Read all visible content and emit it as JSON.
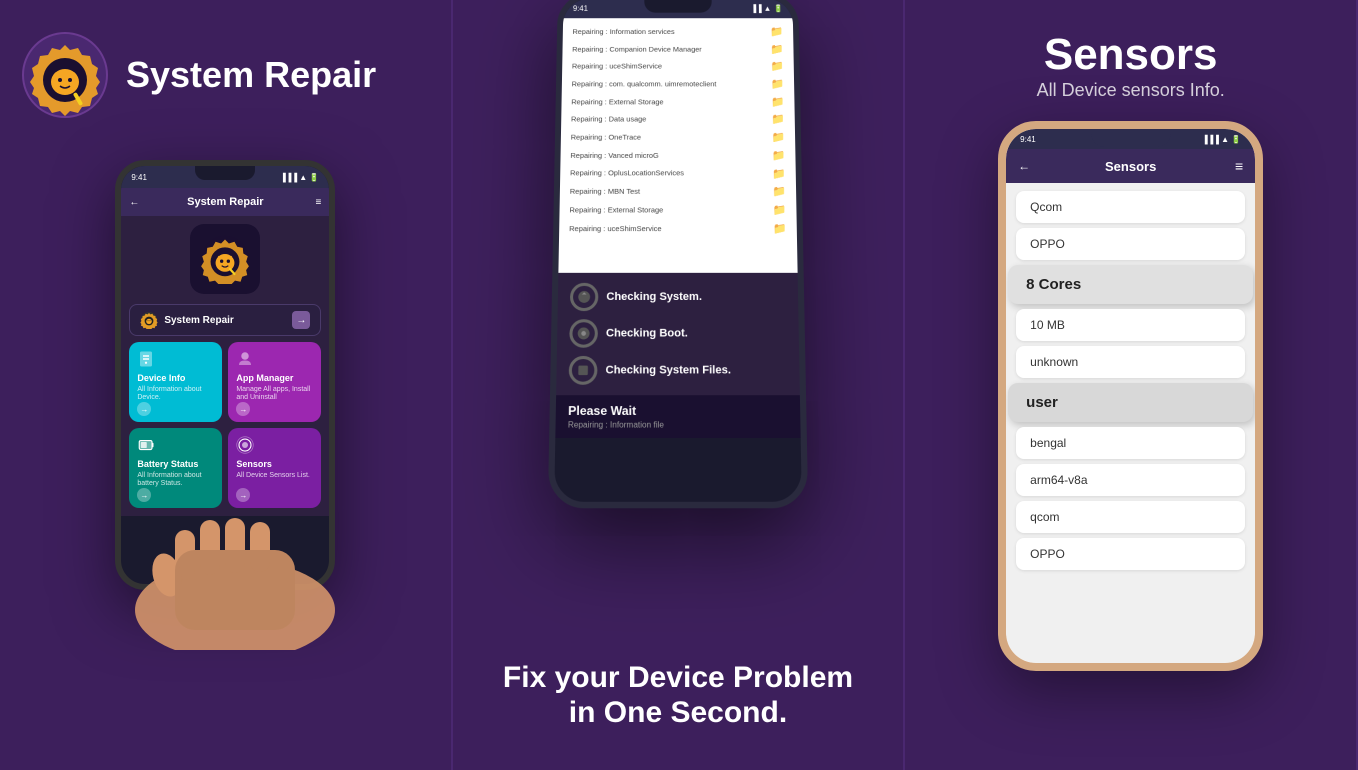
{
  "panel1": {
    "logo_text": "System\nRepair",
    "phone": {
      "time": "9:41",
      "title": "System Repair",
      "app_button_label": "System Repair",
      "features": [
        {
          "id": "device-info",
          "title": "Device Info",
          "subtitle": "All Information about Device.",
          "color": "cyan"
        },
        {
          "id": "app-manager",
          "title": "App Manager",
          "subtitle": "Manage All apps, Install and Uninstall",
          "color": "purple"
        },
        {
          "id": "battery-status",
          "title": "Battery Status",
          "subtitle": "All Information about battery Status.",
          "color": "teal"
        },
        {
          "id": "sensors",
          "title": "Sensors",
          "subtitle": "All Device Sensors List.",
          "color": "violet"
        }
      ]
    }
  },
  "panel2": {
    "repair_items": [
      "Repairing : Information services",
      "Repairing : Companion Device Manager",
      "Repairing : uceShimService",
      "Repairing : com. qualcomm. uimremoteclient",
      "Repairing : External Storage",
      "Repairing : Data usage",
      "Repairing : OneTrace",
      "Repairing : Vanced microG",
      "Repairing : OplusLocationServices",
      "Repairing : MBN Test",
      "Repairing : External Storage",
      "Repairing : uceShimService"
    ],
    "checking_items": [
      "Checking System.",
      "Checking Boot.",
      "Checking System Files."
    ],
    "please_wait": "Please Wait",
    "repairing_sub": "Repairing : Information file",
    "bottom_text_line1": "Fix your Device Problem",
    "bottom_text_line2": "in One Second."
  },
  "panel3": {
    "title": "Sensors",
    "subtitle": "All Device sensors Info.",
    "phone": {
      "time": "9:41",
      "header_title": "Sensors",
      "sensor_items": [
        {
          "label": "Qcom",
          "highlighted": false
        },
        {
          "label": "OPPO",
          "highlighted": false
        },
        {
          "label": "8 Cores",
          "highlighted": true,
          "floating": true
        },
        {
          "label": "10 MB",
          "highlighted": false
        },
        {
          "label": "unknown",
          "highlighted": false
        },
        {
          "label": "user",
          "highlighted": true,
          "floating": true
        },
        {
          "label": "bengal",
          "highlighted": false
        },
        {
          "label": "arm64-v8a",
          "highlighted": false
        },
        {
          "label": "qcom",
          "highlighted": false
        },
        {
          "label": "OPPO",
          "highlighted": false
        }
      ]
    }
  }
}
